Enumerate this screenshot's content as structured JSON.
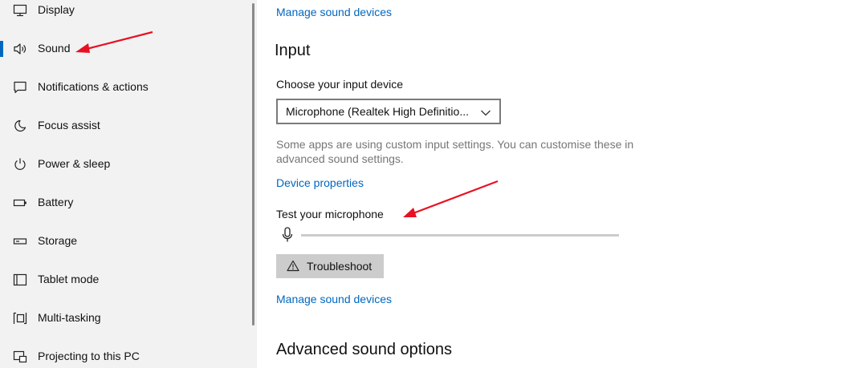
{
  "sidebar": {
    "items": [
      {
        "label": "Display",
        "icon": "display-icon",
        "active": false
      },
      {
        "label": "Sound",
        "icon": "speaker-icon",
        "active": true
      },
      {
        "label": "Notifications & actions",
        "icon": "notification-icon",
        "active": false
      },
      {
        "label": "Focus assist",
        "icon": "moon-icon",
        "active": false
      },
      {
        "label": "Power & sleep",
        "icon": "power-icon",
        "active": false
      },
      {
        "label": "Battery",
        "icon": "battery-icon",
        "active": false
      },
      {
        "label": "Storage",
        "icon": "storage-icon",
        "active": false
      },
      {
        "label": "Tablet mode",
        "icon": "tablet-icon",
        "active": false
      },
      {
        "label": "Multi-tasking",
        "icon": "multitasking-icon",
        "active": false
      },
      {
        "label": "Projecting to this PC",
        "icon": "projector-icon",
        "active": false
      }
    ]
  },
  "main": {
    "top_link": "Manage sound devices",
    "input_heading": "Input",
    "choose_label": "Choose your input device",
    "selected_device": "Microphone (Realtek High Definitio...",
    "description": "Some apps are using custom input settings. You can customise these in advanced sound settings.",
    "device_properties_link": "Device properties",
    "test_label": "Test your microphone",
    "mic_level": 0,
    "troubleshoot_label": "Troubleshoot",
    "manage_link": "Manage sound devices",
    "advanced_heading": "Advanced sound options"
  },
  "colors": {
    "accent": "#0067c0",
    "annotation_arrow": "#e81123"
  }
}
